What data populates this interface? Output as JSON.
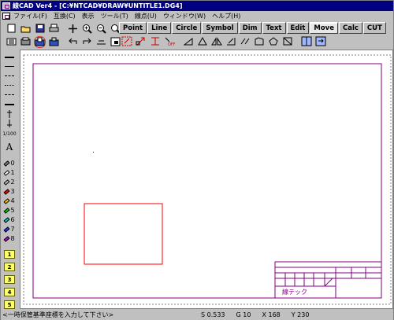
{
  "window": {
    "title": "線CAD Ver4 - [C:¥NTCAD¥DRAW¥UNTITLE1.DG4]"
  },
  "menu": {
    "items": [
      "ファイル(F)",
      "互換(C)",
      "表示",
      "ツール(T)",
      "線点(U)",
      "ウィンドウ(W)",
      "ヘルプ(H)"
    ]
  },
  "tabs": [
    "Point",
    "Line",
    "Circle",
    "Symbol",
    "Dim",
    "Text",
    "Edit",
    "Move",
    "Calc",
    "CUT"
  ],
  "active_tab": "Move",
  "left_palette": {
    "pen_labels": [
      "0",
      "1",
      "2",
      "3",
      "4",
      "5",
      "6",
      "7",
      "8"
    ],
    "layer_labels": [
      "1",
      "2",
      "3",
      "4",
      "5"
    ],
    "text_tool_label": "A",
    "scale_labels": [
      "1/100"
    ]
  },
  "title_block": {
    "company": "線テック"
  },
  "status": {
    "message": "<一時保管基準座標を入力して下さい>",
    "scale": "S 0.533",
    "grid": "G 10",
    "x": "X 168",
    "y": "Y 230"
  },
  "colors": {
    "sheet_border": "#800080",
    "rectangle": "#ff0000",
    "paper_dash": "#808080"
  }
}
